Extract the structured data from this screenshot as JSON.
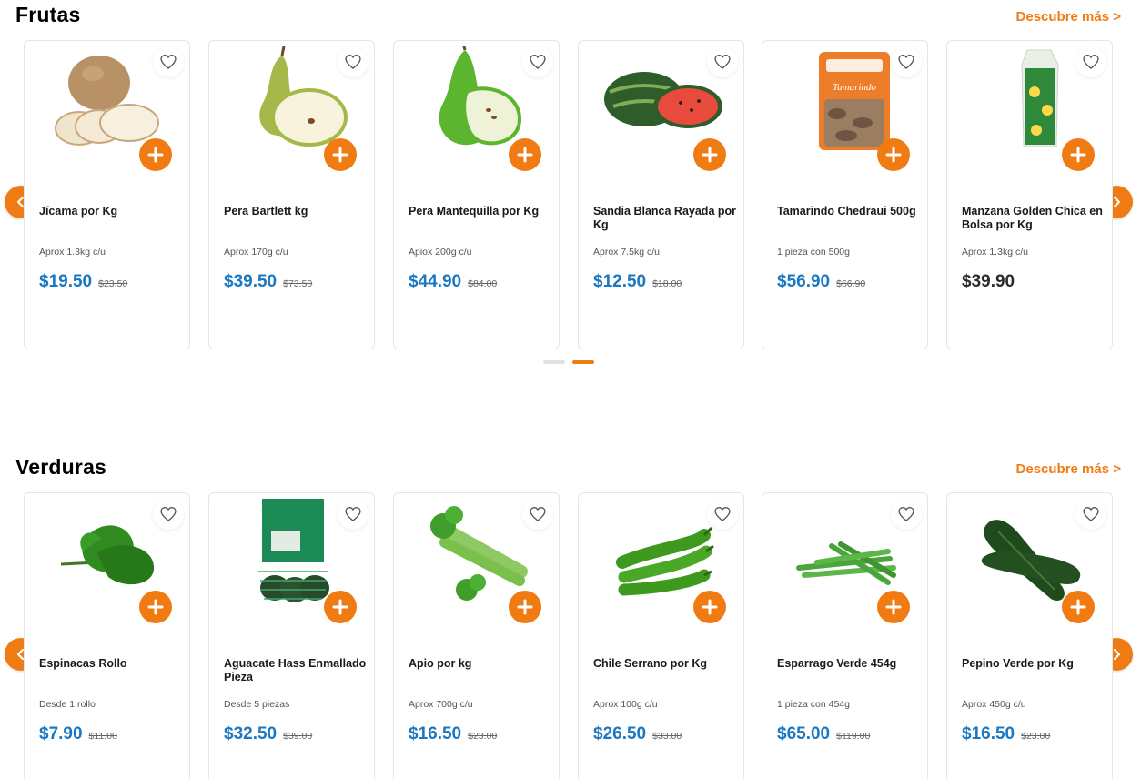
{
  "colors": {
    "accent": "#f07b12",
    "price": "#1a78c2",
    "text": "#1a1a1a"
  },
  "icons": {
    "favorite": "heart-outline-icon",
    "add": "plus-icon",
    "prev": "chevron-left-icon",
    "next": "chevron-right-icon"
  },
  "frutas": {
    "title": "Frutas",
    "discover": "Descubre más >",
    "active_page": 2,
    "pages": 2,
    "products": [
      {
        "name": "Jícama por Kg",
        "desc": "Aprox 1.3kg c/u",
        "price": "$19.50",
        "old": "$23.50",
        "img": "jicama"
      },
      {
        "name": "Pera Bartlett kg",
        "desc": "Aprox 170g c/u",
        "price": "$39.50",
        "old": "$73.50",
        "img": "pear-yellow"
      },
      {
        "name": "Pera Mantequilla por Kg",
        "desc": "Apiox 200g c/u",
        "price": "$44.90",
        "old": "$84.00",
        "img": "pear-green"
      },
      {
        "name": "Sandia Blanca Rayada por Kg",
        "desc": "Aprox 7.5kg c/u",
        "price": "$12.50",
        "old": "$18.00",
        "img": "watermelon"
      },
      {
        "name": "Tamarindo Chedraui 500g",
        "desc": "1 pieza con 500g",
        "price": "$56.90",
        "old": "$66.90",
        "img": "tamarind-bag"
      },
      {
        "name": "Manzana Golden Chica en Bolsa por Kg",
        "desc": "Aprox 1.3kg c/u",
        "price": "$39.90",
        "old": "",
        "img": "apple-bag"
      }
    ]
  },
  "verduras": {
    "title": "Verduras",
    "discover": "Descubre más >",
    "products": [
      {
        "name": "Espinacas Rollo",
        "desc": "Desde 1 rollo",
        "price": "$7.90",
        "old": "$11.00",
        "img": "spinach"
      },
      {
        "name": "Aguacate Hass Enmallado Pieza",
        "desc": "Desde 5 piezas",
        "price": "$32.50",
        "old": "$39.00",
        "img": "avocado-net"
      },
      {
        "name": "Apio por kg",
        "desc": "Aprox 700g c/u",
        "price": "$16.50",
        "old": "$23.00",
        "img": "celery"
      },
      {
        "name": "Chile Serrano por Kg",
        "desc": "Aprox 100g c/u",
        "price": "$26.50",
        "old": "$33.00",
        "img": "chili"
      },
      {
        "name": "Esparrago Verde 454g",
        "desc": "1 pieza con 454g",
        "price": "$65.00",
        "old": "$119.00",
        "img": "asparagus"
      },
      {
        "name": "Pepino Verde por Kg",
        "desc": "Aprox 450g c/u",
        "price": "$16.50",
        "old": "$23.00",
        "img": "cucumber"
      }
    ]
  }
}
